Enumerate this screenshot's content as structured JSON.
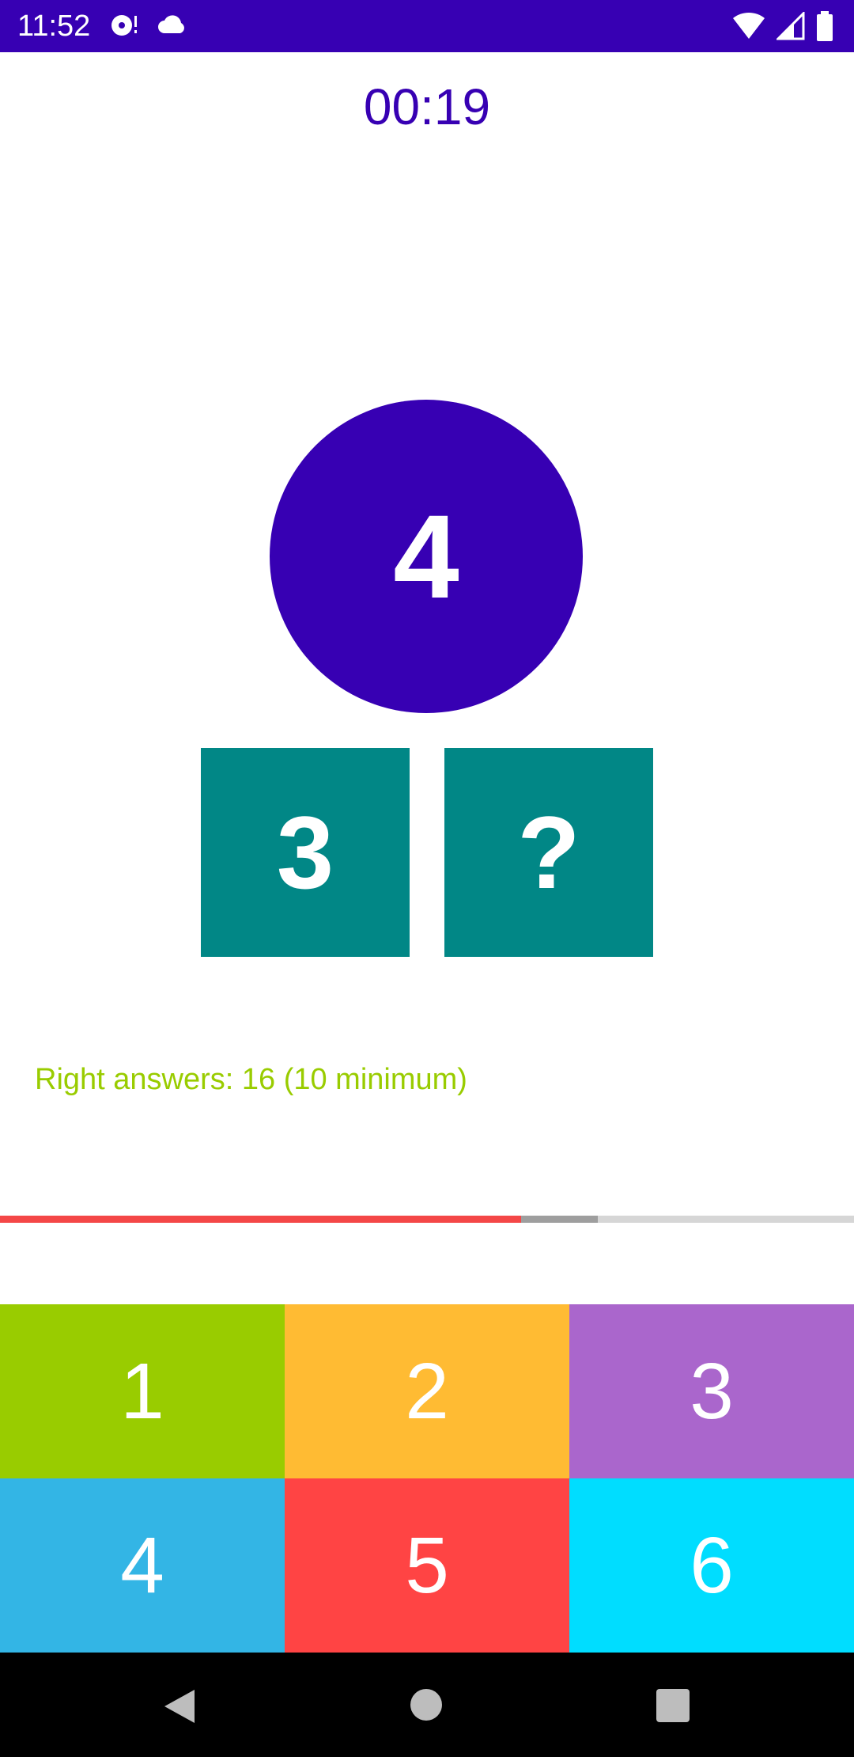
{
  "status_bar": {
    "time": "11:52",
    "left_icons": [
      "media-icon",
      "cloud-icon"
    ],
    "right_icons": [
      "wifi-icon",
      "signal-icon",
      "battery-icon"
    ],
    "background": "#3700b3"
  },
  "timer": "00:19",
  "question": {
    "circle_value": "4",
    "left_square": "3",
    "right_square": "?"
  },
  "right_answers_text": "Right answers: 16 (10 minimum)",
  "progress": {
    "primary_fraction": 0.61,
    "secondary_fraction": 0.7,
    "primary_color": "#f44747",
    "secondary_color": "#9e9e9e",
    "track_color": "#d6d6d6"
  },
  "numpad": {
    "keys": [
      {
        "label": "1",
        "color": "#99cc00"
      },
      {
        "label": "2",
        "color": "#ffbb33"
      },
      {
        "label": "3",
        "color": "#aa66cc"
      },
      {
        "label": "4",
        "color": "#33b5e5"
      },
      {
        "label": "5",
        "color": "#ff4444"
      },
      {
        "label": "6",
        "color": "#00ddff"
      }
    ]
  },
  "nav_bar": {
    "buttons": [
      "back-icon",
      "home-icon",
      "recents-icon"
    ]
  }
}
